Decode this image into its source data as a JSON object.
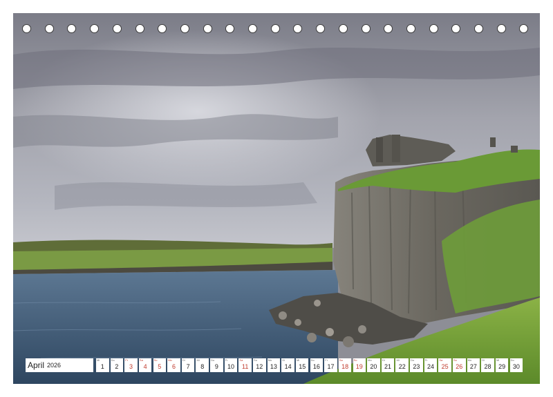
{
  "calendar": {
    "month": "April",
    "year": "2026",
    "days": [
      {
        "num": "1",
        "dow": "Mi",
        "weekend": false
      },
      {
        "num": "2",
        "dow": "Do",
        "weekend": false
      },
      {
        "num": "3",
        "dow": "Fr",
        "weekend": true
      },
      {
        "num": "4",
        "dow": "Sa",
        "weekend": true
      },
      {
        "num": "5",
        "dow": "So",
        "weekend": true
      },
      {
        "num": "6",
        "dow": "Mo",
        "weekend": true
      },
      {
        "num": "7",
        "dow": "Di",
        "weekend": false
      },
      {
        "num": "8",
        "dow": "Mi",
        "weekend": false
      },
      {
        "num": "9",
        "dow": "Do",
        "weekend": false
      },
      {
        "num": "10",
        "dow": "Fr",
        "weekend": false
      },
      {
        "num": "11",
        "dow": "Sa",
        "weekend": true
      },
      {
        "num": "12",
        "dow": "So",
        "weekend": false
      },
      {
        "num": "13",
        "dow": "Mo",
        "weekend": false
      },
      {
        "num": "14",
        "dow": "Di",
        "weekend": false
      },
      {
        "num": "15",
        "dow": "Mi",
        "weekend": false
      },
      {
        "num": "16",
        "dow": "Do",
        "weekend": false
      },
      {
        "num": "17",
        "dow": "Fr",
        "weekend": false
      },
      {
        "num": "18",
        "dow": "Sa",
        "weekend": true
      },
      {
        "num": "19",
        "dow": "So",
        "weekend": true
      },
      {
        "num": "20",
        "dow": "Mo",
        "weekend": false
      },
      {
        "num": "21",
        "dow": "Di",
        "weekend": false
      },
      {
        "num": "22",
        "dow": "Mi",
        "weekend": false
      },
      {
        "num": "23",
        "dow": "Do",
        "weekend": false
      },
      {
        "num": "24",
        "dow": "Fr",
        "weekend": false
      },
      {
        "num": "25",
        "dow": "Sa",
        "weekend": true
      },
      {
        "num": "26",
        "dow": "So",
        "weekend": true
      },
      {
        "num": "27",
        "dow": "Mo",
        "weekend": false
      },
      {
        "num": "28",
        "dow": "Di",
        "weekend": false
      },
      {
        "num": "29",
        "dow": "Mi",
        "weekend": false
      },
      {
        "num": "30",
        "dow": "Do",
        "weekend": false
      }
    ]
  },
  "colors": {
    "sky": "#9a9ba4",
    "water": "#3e5a78",
    "grass": "#6e9a34",
    "cliff": "#6e6c66",
    "weekend_text": "#c0392b"
  }
}
